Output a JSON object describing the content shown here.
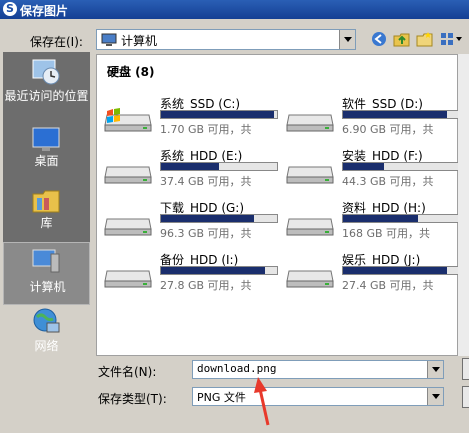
{
  "window": {
    "title": "保存图片"
  },
  "toolbar": {
    "save_in_label": "保存在(I):",
    "location": "计算机",
    "icons": [
      "back-icon",
      "up-folder-icon",
      "new-folder-icon",
      "view-menu-icon"
    ]
  },
  "places": [
    {
      "name": "recent",
      "label": "最近访问的位置",
      "icon": "recent-places-icon"
    },
    {
      "name": "desktop",
      "label": "桌面",
      "icon": "desktop-icon"
    },
    {
      "name": "libraries",
      "label": "库",
      "icon": "library-icon"
    },
    {
      "name": "computer",
      "label": "计算机",
      "icon": "computer-icon",
      "selected": true
    },
    {
      "name": "network",
      "label": "网络",
      "icon": "network-icon"
    }
  ],
  "group_header": "硬盘 (8)",
  "drives": [
    {
      "name": "系统_SSD (C:)",
      "free": "1.70 GB 可用，共",
      "used": 0.97,
      "system": true
    },
    {
      "name": "软件_SSD (D:)",
      "free": "6.90 GB 可用，共",
      "used": 0.9
    },
    {
      "name": "系统_HDD (E:)",
      "free": "37.4 GB 可用，共",
      "used": 0.5
    },
    {
      "name": "安装_HDD (F:)",
      "free": "44.3 GB 可用，共",
      "used": 0.35
    },
    {
      "name": "下载_HDD (G:)",
      "free": "96.3 GB 可用，共",
      "used": 0.8
    },
    {
      "name": "资料_HDD (H:)",
      "free": "168 GB 可用，共",
      "used": 0.65
    },
    {
      "name": "备份_HDD (I:)",
      "free": "27.8 GB 可用，共",
      "used": 0.9
    },
    {
      "name": "娱乐_HDD (J:)",
      "free": "27.4 GB 可用，共",
      "used": 0.9
    }
  ],
  "form": {
    "filename_label": "文件名(N):",
    "filename_value": "download.png",
    "filetype_label": "保存类型(T):",
    "filetype_value": "PNG 文件"
  },
  "colors": {
    "title_bar": "#1c4ea6",
    "usage_bar": "#1a2e6d",
    "annotation_arrow": "#e8392b"
  }
}
